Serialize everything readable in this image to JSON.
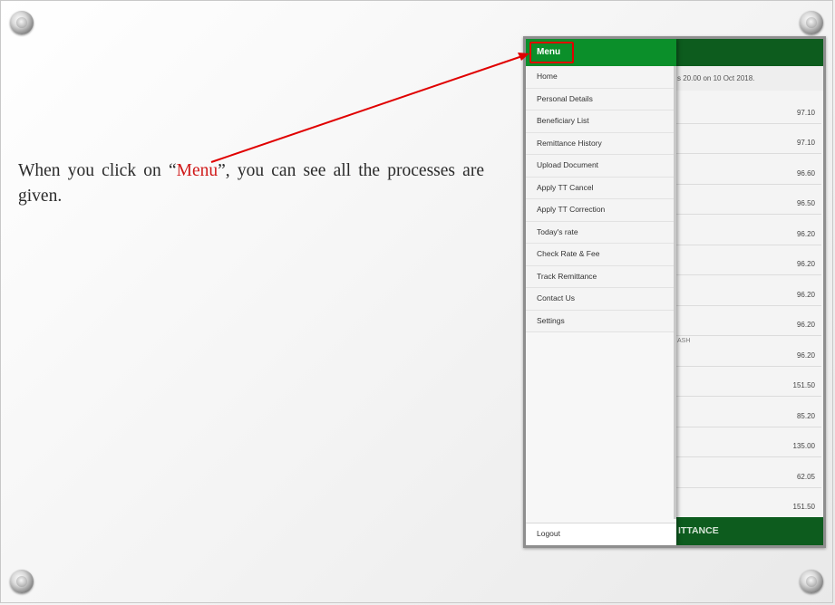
{
  "slide": {
    "caption_before": "When you click on “",
    "caption_highlight": "Menu",
    "caption_after": "”, you can see all the processes are given."
  },
  "app": {
    "notice_text": "s 20.00 on 10 Oct 2018.",
    "rates": [
      {
        "value": "97.10",
        "sub": ""
      },
      {
        "value": "97.10",
        "sub": ""
      },
      {
        "value": "96.60",
        "sub": ""
      },
      {
        "value": "96.50",
        "sub": ""
      },
      {
        "value": "96.20",
        "sub": ""
      },
      {
        "value": "96.20",
        "sub": ""
      },
      {
        "value": "96.20",
        "sub": ""
      },
      {
        "value": "96.20",
        "sub": ""
      },
      {
        "value": "96.20",
        "sub": "ASH"
      },
      {
        "value": "151.50",
        "sub": ""
      },
      {
        "value": "85.20",
        "sub": ""
      },
      {
        "value": "135.00",
        "sub": ""
      },
      {
        "value": "62.05",
        "sub": ""
      },
      {
        "value": "151.50",
        "sub": ""
      }
    ],
    "footer_text": "ITTANCE"
  },
  "drawer": {
    "title": "Menu",
    "items": [
      "Home",
      "Personal Details",
      "Beneficiary List",
      "Remittance History",
      "Upload Document",
      "Apply TT Cancel",
      "Apply TT Correction",
      "Today's rate",
      "Check Rate & Fee",
      "Track Remittance",
      "Contact Us",
      "Settings"
    ],
    "logout": "Logout"
  },
  "colors": {
    "header_dark_green": "#0d5c1e",
    "drawer_green": "#0b8f2a",
    "highlight_red": "#e00000",
    "caption_red": "#d01a1a"
  }
}
